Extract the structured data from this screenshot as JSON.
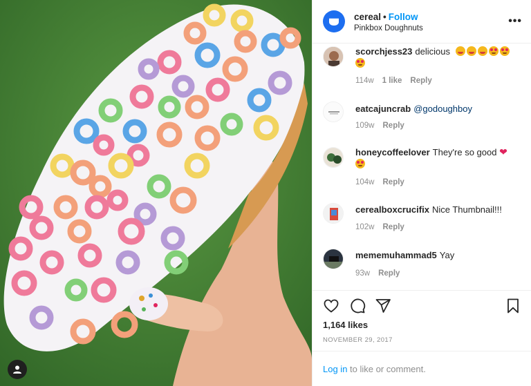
{
  "post": {
    "username": "cereal",
    "follow_label": "Follow",
    "separator": "•",
    "location": "Pinkbox Doughnuts",
    "more_label": "•••"
  },
  "comments": [
    {
      "user": "scorchjess23",
      "text": "delicious",
      "mention": "",
      "time": "114w",
      "likes": "1 like",
      "reply": "Reply",
      "emojis": [
        "yum",
        "yum",
        "yum",
        "heart-eyes",
        "heart-eyes",
        "heart-eyes"
      ]
    },
    {
      "user": "eatcajuncrab",
      "text": "",
      "mention": "@godoughboy",
      "time": "109w",
      "likes": "",
      "reply": "Reply"
    },
    {
      "user": "honeycoffeelover",
      "text": "They're so good",
      "mention": "",
      "time": "104w",
      "likes": "",
      "reply": "Reply",
      "emojis": [
        "heart",
        "heart-eyes"
      ]
    },
    {
      "user": "cerealboxcrucifix",
      "text": "Nice Thumbnail!!!",
      "mention": "",
      "time": "102w",
      "likes": "",
      "reply": "Reply"
    },
    {
      "user": "mememuhammad5",
      "text": "Yay",
      "mention": "",
      "time": "93w",
      "likes": "",
      "reply": "Reply"
    }
  ],
  "footer": {
    "likes": "1,164 likes",
    "date": "NOVEMBER 29, 2017",
    "login_link": "Log in",
    "login_rest": " to like or comment."
  },
  "icons": {
    "like": "heart-icon",
    "comment": "comment-icon",
    "share": "share-icon",
    "save": "bookmark-icon",
    "tag": "user-tag-icon"
  },
  "colors": {
    "accent": "#0095f6",
    "brand_avatar": "#1d6ef0",
    "muted": "#8e8e8e"
  }
}
